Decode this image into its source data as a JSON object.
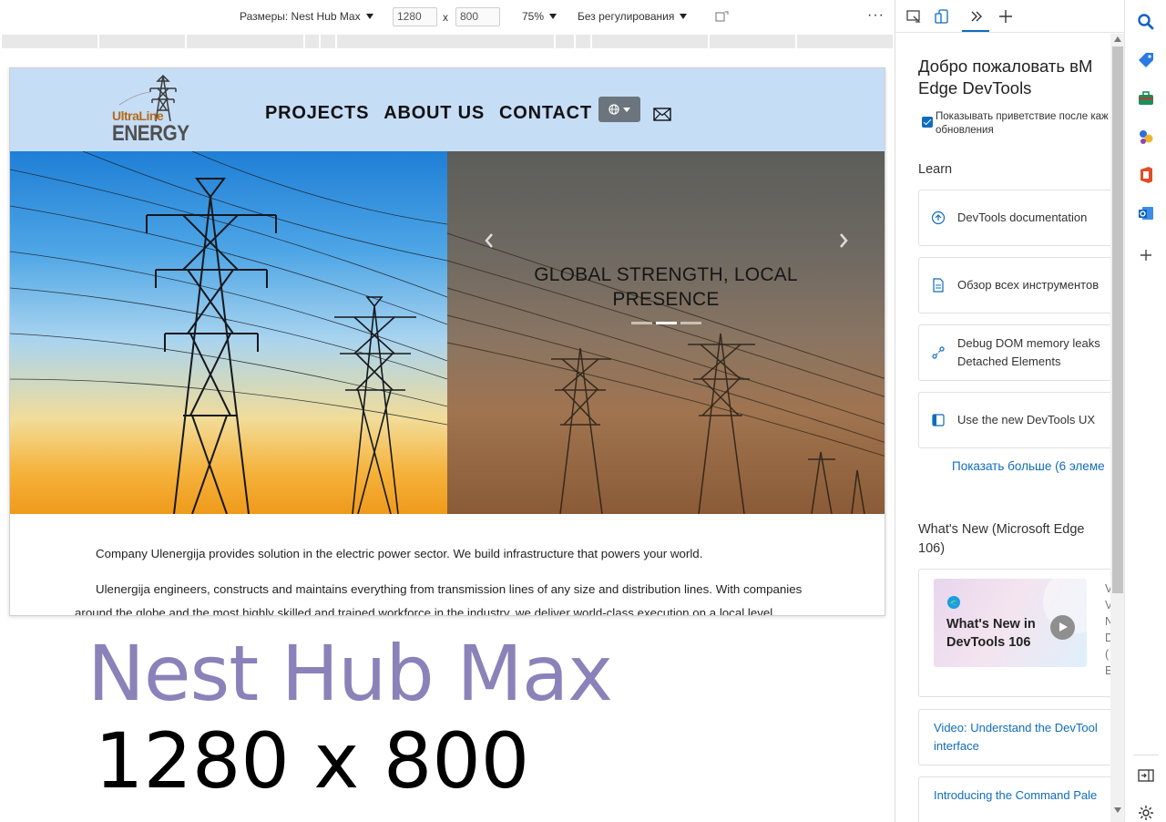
{
  "toolbar": {
    "dimensions_label": "Размеры: Nest Hub Max",
    "width": "1280",
    "height": "800",
    "times": "x",
    "zoom": "75%",
    "throttling": "Без регулирования",
    "more": "···"
  },
  "site": {
    "logo_line1": "UltraLine",
    "logo_line2": "ENERGY",
    "nav": [
      "PROJECTS",
      "ABOUT US",
      "CONTACT"
    ],
    "hero_caption": [
      "GLOBAL STRENGTH, LOCAL",
      "PRESENCE"
    ],
    "slides_total": 3,
    "slides_active_index": 1,
    "paragraphs": [
      "Company Ulenergija provides solution in the electric power sector. We build infrastructure that powers your world.",
      "Ulenergija engineers, constructs and maintains everything from transmission lines of any size and distribution lines. With companies",
      "around the globe and the most highly skilled and trained workforce in the industry, we deliver world-class execution on a local level."
    ]
  },
  "overlay": {
    "device_name": "Nest Hub Max",
    "device_dims": "1280 x 800"
  },
  "devtools": {
    "welcome_line1": "Добро пожаловать вM",
    "welcome_line2": "Edge DevTools",
    "show_welcome_line1": "Показывать приветствие после каж",
    "show_welcome_line2": "обновления",
    "learn_heading": "Learn",
    "cards": [
      {
        "line1": "DevTools documentation",
        "line2": ""
      },
      {
        "line1": "Обзор всех инструментов",
        "line2": ""
      },
      {
        "line1": "Debug DOM memory leaks",
        "line2": "Detached Elements"
      },
      {
        "line1": "Use the new DevTools UX",
        "line2": ""
      }
    ],
    "show_more": "Показать больше (6 элеме",
    "whats_new_line1": "What's New (Microsoft Edge",
    "whats_new_line2": "106)",
    "video_thumb_line1": "What's New in",
    "video_thumb_line2": "DevTools 106",
    "video_side_letters": [
      "V",
      "V",
      "N",
      "D",
      "(",
      "E"
    ],
    "link_cards": [
      {
        "line1": "Video: Understand the DevTool",
        "line2": "interface"
      },
      {
        "line1": "Introducing the Command Pale",
        "line2": ""
      }
    ]
  },
  "colors": {
    "header_bg": "#c6ddf6",
    "accent": "#0f6cbd",
    "overlay_title": "#8a82b9"
  }
}
